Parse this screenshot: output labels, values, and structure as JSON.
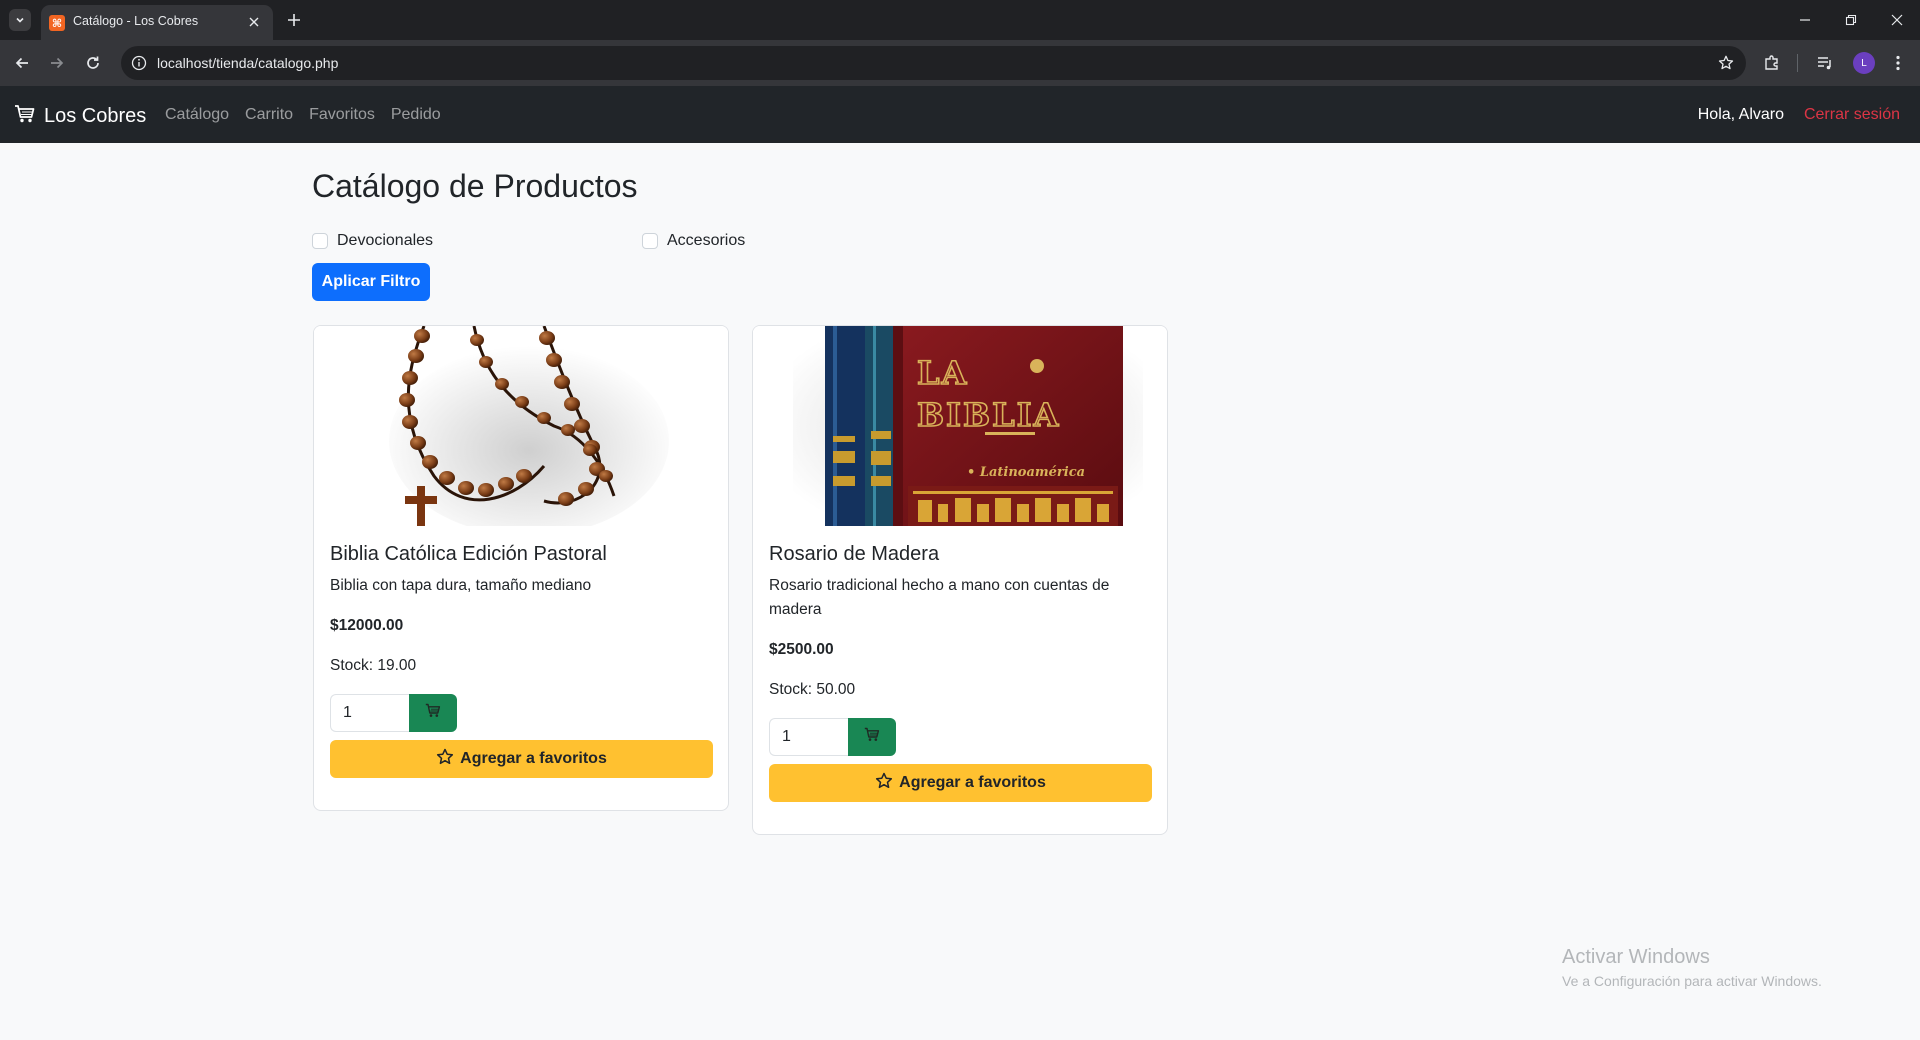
{
  "browser": {
    "tab_title": "Catálogo - Los Cobres",
    "url": "localhost/tienda/catalogo.php",
    "profile_initial": "L"
  },
  "navbar": {
    "brand": "Los Cobres",
    "links": [
      "Catálogo",
      "Carrito",
      "Favoritos",
      "Pedido"
    ],
    "greeting": "Hola, Alvaro",
    "logout": "Cerrar sesión"
  },
  "page": {
    "title": "Catálogo de Productos",
    "filters": [
      {
        "label": "Devocionales",
        "checked": false
      },
      {
        "label": "Accesorios",
        "checked": false
      }
    ],
    "apply_button": "Aplicar Filtro"
  },
  "products": [
    {
      "image": "rosary-beads-image",
      "name": "Biblia Católica Edición Pastoral",
      "description": "Biblia con tapa dura, tamaño mediano",
      "price": "$12000.00",
      "stock": "Stock: 19.00",
      "quantity": "1",
      "favorite_label": "Agregar a favoritos"
    },
    {
      "image": "bible-books-image",
      "name": "Rosario de Madera",
      "description": "Rosario tradicional hecho a mano con cuentas de madera",
      "price": "$2500.00",
      "stock": "Stock: 50.00",
      "quantity": "1",
      "favorite_label": "Agregar a favoritos"
    }
  ],
  "watermark": {
    "title": "Activar Windows",
    "subtitle": "Ve a Configuración para activar Windows."
  },
  "colors": {
    "navbar_bg": "#212529",
    "primary": "#0d6efd",
    "success": "#198754",
    "warning": "#ffc130",
    "danger": "#dc3545"
  }
}
